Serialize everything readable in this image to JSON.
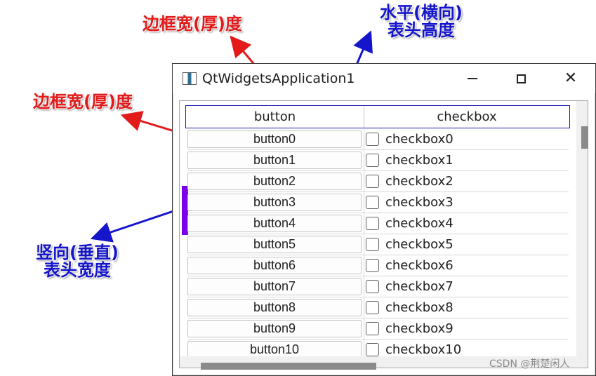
{
  "window": {
    "title": "QtWidgetsApplication1",
    "close_symbol": "✕"
  },
  "table": {
    "headers": [
      "button",
      "checkbox"
    ],
    "rows": [
      {
        "button": "button0",
        "checkbox": "checkbox0"
      },
      {
        "button": "button1",
        "checkbox": "checkbox1"
      },
      {
        "button": "button2",
        "checkbox": "checkbox2"
      },
      {
        "button": "button3",
        "checkbox": "checkbox3"
      },
      {
        "button": "button4",
        "checkbox": "checkbox4"
      },
      {
        "button": "button5",
        "checkbox": "checkbox5"
      },
      {
        "button": "button6",
        "checkbox": "checkbox6"
      },
      {
        "button": "button7",
        "checkbox": "checkbox7"
      },
      {
        "button": "button8",
        "checkbox": "checkbox8"
      },
      {
        "button": "button9",
        "checkbox": "checkbox9"
      },
      {
        "button": "button10",
        "checkbox": "checkbox10"
      }
    ]
  },
  "annotations": {
    "top_right": [
      "水平(横向)",
      "表头高度"
    ],
    "top_left": "边框宽(厚)度",
    "left_mid": "边框宽(厚)度",
    "left_bottom": [
      "竖向(垂直)",
      "表头宽度"
    ]
  },
  "watermark": "CSDN @荆楚闲人",
  "colors": {
    "annotation_red": "#e31a1a",
    "annotation_blue": "#1515cc",
    "vertical_header_marker": "#7a00ea",
    "header_border": "#1a1ab5"
  },
  "icons": {
    "app": "app-icon",
    "minimize": "minimize-icon",
    "maximize": "maximize-icon",
    "close": "close-icon"
  }
}
